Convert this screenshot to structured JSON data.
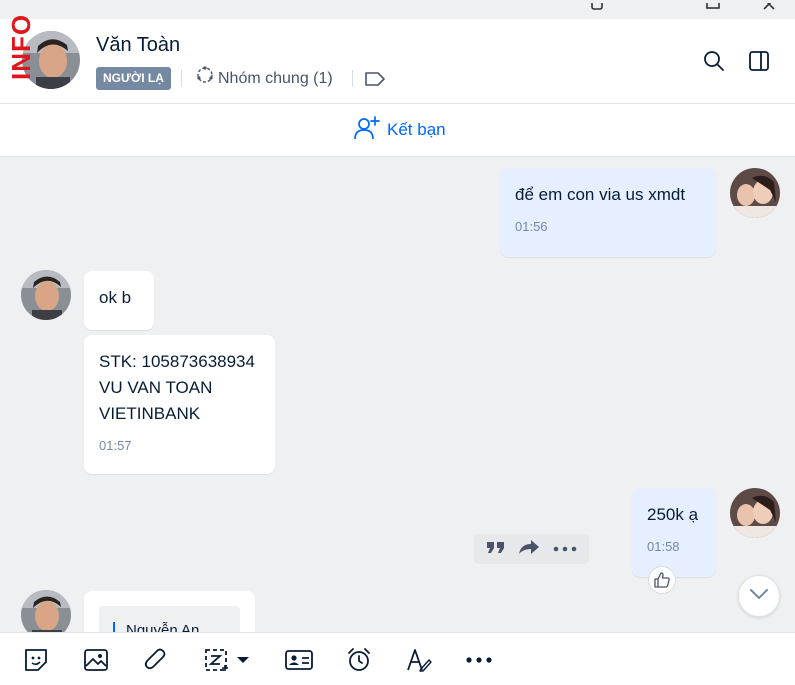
{
  "watermark": "INFO",
  "header": {
    "name": "Văn Toàn",
    "badge": "NGƯỜI LẠ",
    "group_label": "Nhóm chung (1)"
  },
  "friend_bar": {
    "add_friend_label": "Kết bạn"
  },
  "messages": [
    {
      "direction": "out",
      "text": "để em con via us xmdt",
      "time": "01:56"
    },
    {
      "direction": "in",
      "text": "ok b",
      "time": ""
    },
    {
      "direction": "in",
      "lines": [
        "STK: 105873638934",
        "VU VAN TOAN",
        "VIETINBANK"
      ],
      "time": "01:57"
    },
    {
      "direction": "out",
      "text": "250k ạ",
      "time": "01:58"
    },
    {
      "direction": "in",
      "quote_name": "Nguyễn An",
      "time": ""
    }
  ],
  "colors": {
    "accent": "#0068ff",
    "badge_bg": "#7589a3",
    "chat_bg": "#eef0f1",
    "outgoing_bubble": "#e5efff",
    "watermark": "#e1161c"
  },
  "icons": {
    "search": "search-icon",
    "sidebar": "sidebar-toggle-icon",
    "tag": "tag-icon",
    "group": "group-icon",
    "add_friend": "add-friend-icon",
    "quote": "quote-icon",
    "forward": "forward-icon",
    "more": "more-icon",
    "like": "thumbs-up-icon",
    "scroll": "chevron-down-icon",
    "toolbar": [
      "sticker-icon",
      "image-icon",
      "attachment-icon",
      "screenshot-icon",
      "contact-card-icon",
      "reminder-icon",
      "text-format-icon",
      "more-icon"
    ]
  }
}
